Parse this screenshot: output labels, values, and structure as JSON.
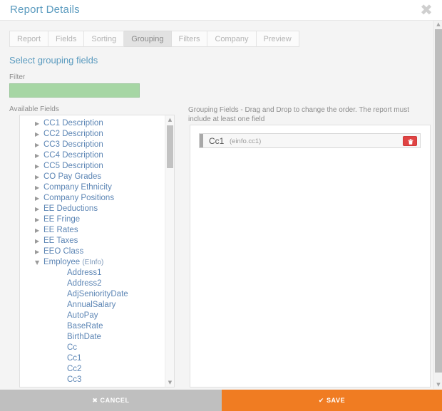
{
  "header": {
    "title": "Report Details",
    "close_icon": "close-icon",
    "close_glyph": "✖"
  },
  "tabs": [
    {
      "label": "Report",
      "active": false
    },
    {
      "label": "Fields",
      "active": false
    },
    {
      "label": "Sorting",
      "active": false
    },
    {
      "label": "Grouping",
      "active": true
    },
    {
      "label": "Filters",
      "active": false
    },
    {
      "label": "Company",
      "active": false
    },
    {
      "label": "Preview",
      "active": false
    }
  ],
  "section": {
    "title": "Select grouping fields"
  },
  "filter": {
    "label": "Filter",
    "value": "",
    "placeholder": ""
  },
  "available_fields": {
    "label": "Available Fields",
    "collapsed_glyph": "▶",
    "expanded_glyph": "▼",
    "nodes": [
      {
        "label": "CC1 Description",
        "expanded": false
      },
      {
        "label": "CC2 Description",
        "expanded": false
      },
      {
        "label": "CC3 Description",
        "expanded": false
      },
      {
        "label": "CC4 Description",
        "expanded": false
      },
      {
        "label": "CC5 Description",
        "expanded": false
      },
      {
        "label": "CO Pay Grades",
        "expanded": false
      },
      {
        "label": "Company Ethnicity",
        "expanded": false
      },
      {
        "label": "Company Positions",
        "expanded": false
      },
      {
        "label": "EE Deductions",
        "expanded": false
      },
      {
        "label": "EE Fringe",
        "expanded": false
      },
      {
        "label": "EE Rates",
        "expanded": false
      },
      {
        "label": "EE Taxes",
        "expanded": false
      },
      {
        "label": "EEO Class",
        "expanded": false
      },
      {
        "label": "Employee",
        "sub": "(EInfo)",
        "expanded": true
      }
    ],
    "children": [
      "Address1",
      "Address2",
      "AdjSeniorityDate",
      "AnnualSalary",
      "AutoPay",
      "BaseRate",
      "BirthDate",
      "Cc",
      "Cc1",
      "Cc2",
      "Cc3"
    ]
  },
  "grouping": {
    "description": "Grouping Fields - Drag and Drop to change the order. The report must include at least one field",
    "items": [
      {
        "name": "Cc1",
        "path": "(einfo.cc1)",
        "delete_icon": "trash-icon"
      }
    ]
  },
  "scrollbars": {
    "up_glyph": "▲",
    "down_glyph": "▼"
  },
  "footer": {
    "cancel_label": "CANCEL",
    "cancel_glyph": "✖",
    "save_label": "SAVE",
    "save_glyph": "✔"
  },
  "colors": {
    "title_blue": "#5b9bbf",
    "tree_blue": "#5d86b5",
    "filter_green": "#a6d6a4",
    "save_orange": "#f07c22",
    "cancel_gray": "#bfbfbf",
    "delete_red": "#e04343"
  }
}
